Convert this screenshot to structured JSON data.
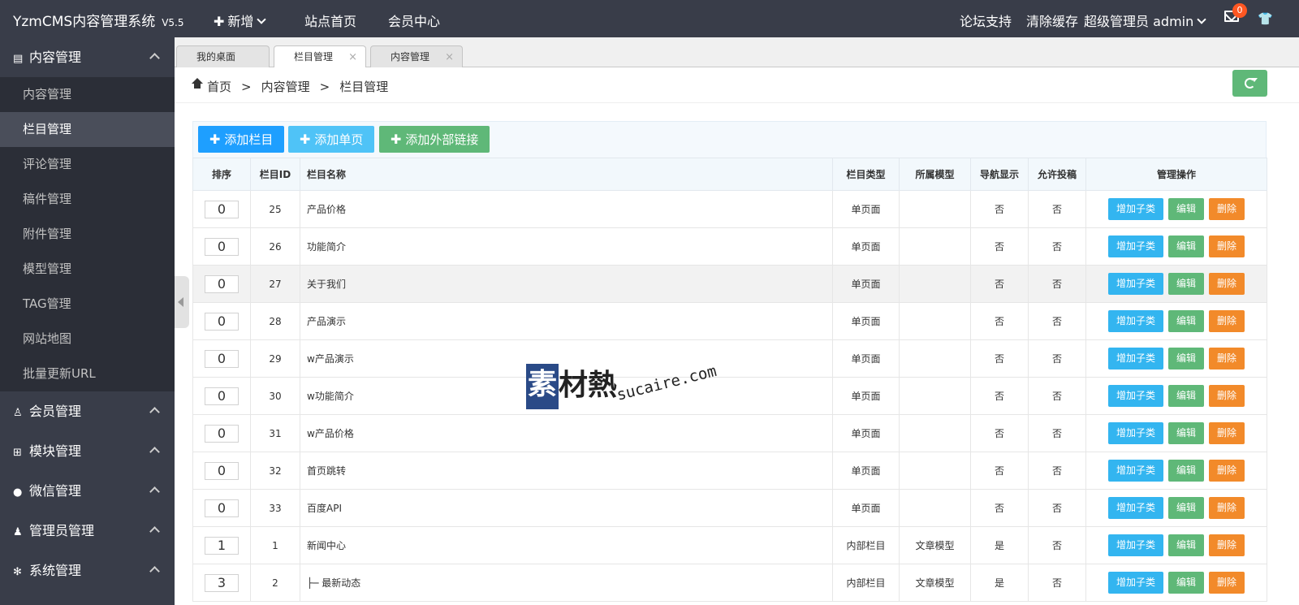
{
  "header": {
    "logo": "YzmCMS内容管理系统",
    "version": "V5.5",
    "nav_new": "新增",
    "nav_site_home": "站点首页",
    "nav_member_center": "会员中心",
    "forum_support": "论坛支持",
    "clear_cache": "清除缓存",
    "role": "超级管理员",
    "username": "admin",
    "unread_count": "0"
  },
  "sidebar": {
    "groups": [
      {
        "label": "内容管理",
        "icon": "book-icon",
        "items": [
          "内容管理",
          "栏目管理",
          "评论管理",
          "稿件管理",
          "附件管理",
          "模型管理",
          "TAG管理",
          "网站地图",
          "批量更新URL"
        ]
      },
      {
        "label": "会员管理",
        "icon": "user-icon"
      },
      {
        "label": "模块管理",
        "icon": "grid-icon"
      },
      {
        "label": "微信管理",
        "icon": "wechat-icon"
      },
      {
        "label": "管理员管理",
        "icon": "admin-icon"
      },
      {
        "label": "系统管理",
        "icon": "gear-icon"
      }
    ],
    "active_item": "栏目管理"
  },
  "tabs": [
    {
      "label": "我的桌面",
      "closable": false
    },
    {
      "label": "栏目管理",
      "closable": true
    },
    {
      "label": "内容管理",
      "closable": true
    }
  ],
  "tab_close": "×",
  "breadcrumb": {
    "home": "首页",
    "sep": ">",
    "level1": "内容管理",
    "level2": "栏目管理"
  },
  "toolbar": {
    "add_category": "添加栏目",
    "add_single_page": "添加单页",
    "add_external_link": "添加外部链接"
  },
  "colors": {
    "topbar": "#393D49",
    "primary_blue": "#1E9FFF",
    "add_btn": "#33b5f0",
    "edit_btn": "#5FB878",
    "delete_btn": "#F28A2A",
    "single_page_text": "#008000",
    "no_red": "#d9534f"
  },
  "table": {
    "headers": [
      "排序",
      "栏目ID",
      "栏目名称",
      "栏目类型",
      "所属模型",
      "导航显示",
      "允许投稿",
      "管理操作"
    ],
    "action_add_child": "增加子类",
    "action_edit": "编辑",
    "action_delete": "删除",
    "rows": [
      {
        "order": "0",
        "id": "25",
        "name": "产品价格",
        "type": "单页面",
        "model": "",
        "nav": "否",
        "submit": "否"
      },
      {
        "order": "0",
        "id": "26",
        "name": "功能简介",
        "type": "单页面",
        "model": "",
        "nav": "否",
        "submit": "否"
      },
      {
        "order": "0",
        "id": "27",
        "name": "关于我们",
        "type": "单页面",
        "model": "",
        "nav": "否",
        "submit": "否"
      },
      {
        "order": "0",
        "id": "28",
        "name": "产品演示",
        "type": "单页面",
        "model": "",
        "nav": "否",
        "submit": "否"
      },
      {
        "order": "0",
        "id": "29",
        "name": "w产品演示",
        "type": "单页面",
        "model": "",
        "nav": "否",
        "submit": "否"
      },
      {
        "order": "0",
        "id": "30",
        "name": "w功能简介",
        "type": "单页面",
        "model": "",
        "nav": "否",
        "submit": "否"
      },
      {
        "order": "0",
        "id": "31",
        "name": "w产品价格",
        "type": "单页面",
        "model": "",
        "nav": "否",
        "submit": "否"
      },
      {
        "order": "0",
        "id": "32",
        "name": "首页跳转",
        "type": "单页面",
        "model": "",
        "nav": "否",
        "submit": "否"
      },
      {
        "order": "0",
        "id": "33",
        "name": "百度API",
        "type": "单页面",
        "model": "",
        "nav": "否",
        "submit": "否"
      },
      {
        "order": "1",
        "id": "1",
        "name": "新闻中心",
        "type": "内部栏目",
        "model": "文章模型",
        "nav": "是",
        "submit": "否"
      },
      {
        "order": "3",
        "id": "2",
        "name": "├─ 最新动态",
        "type": "内部栏目",
        "model": "文章模型",
        "nav": "是",
        "submit": "否"
      }
    ]
  },
  "watermark": {
    "brand_first": "素",
    "brand_rest": "材熱",
    "url": "sucaire.com"
  }
}
